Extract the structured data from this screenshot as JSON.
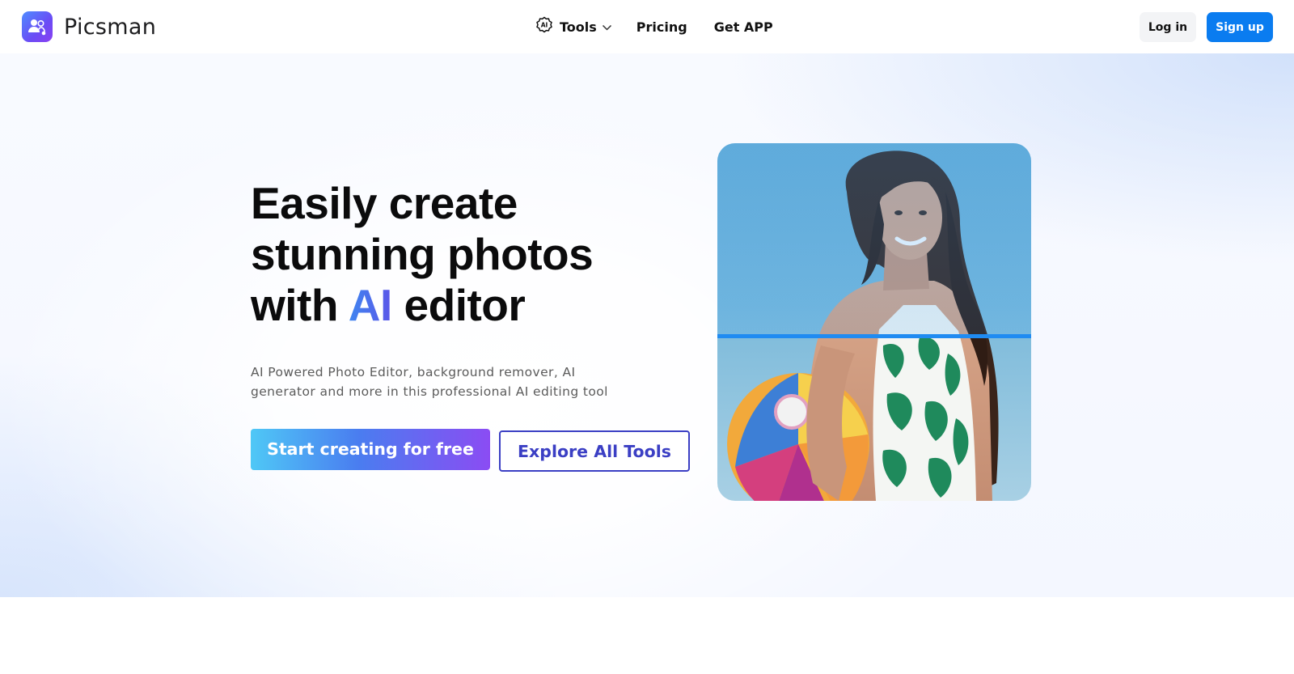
{
  "brand": {
    "name": "Picsman",
    "logo_icon": "people-icon"
  },
  "nav": {
    "tools": {
      "label": "Tools",
      "icon": "ai-badge-icon",
      "caret": "chevron-down-icon",
      "badge_text": "AI"
    },
    "pricing": "Pricing",
    "get_app": "Get APP"
  },
  "auth": {
    "login": "Log in",
    "signup": "Sign up"
  },
  "hero": {
    "headline_line1": "Easily create",
    "headline_line2": "stunning photos",
    "headline_line3_pre": "with",
    "headline_line3_ai": "AI",
    "headline_line3_post": "editor",
    "subtitle": "AI Powered Photo Editor, background remover, AI generator and more in this professional AI editing tool",
    "cta_primary": "Start creating for free",
    "cta_secondary": "Explore All Tools",
    "image_alt": "Woman in tropical swimsuit holding a beach ball against blue sky, split by a background-removal scan line"
  },
  "colors": {
    "primary_blue": "#0a7cf0",
    "accent_indigo": "#3b3fc4",
    "cta_gradient": [
      "#4fc8f6",
      "#4a7df0",
      "#8b4cf3"
    ],
    "ai_gradient": [
      "#3f86f0",
      "#5b55e8"
    ],
    "scan_line": "#1f8bf2"
  }
}
